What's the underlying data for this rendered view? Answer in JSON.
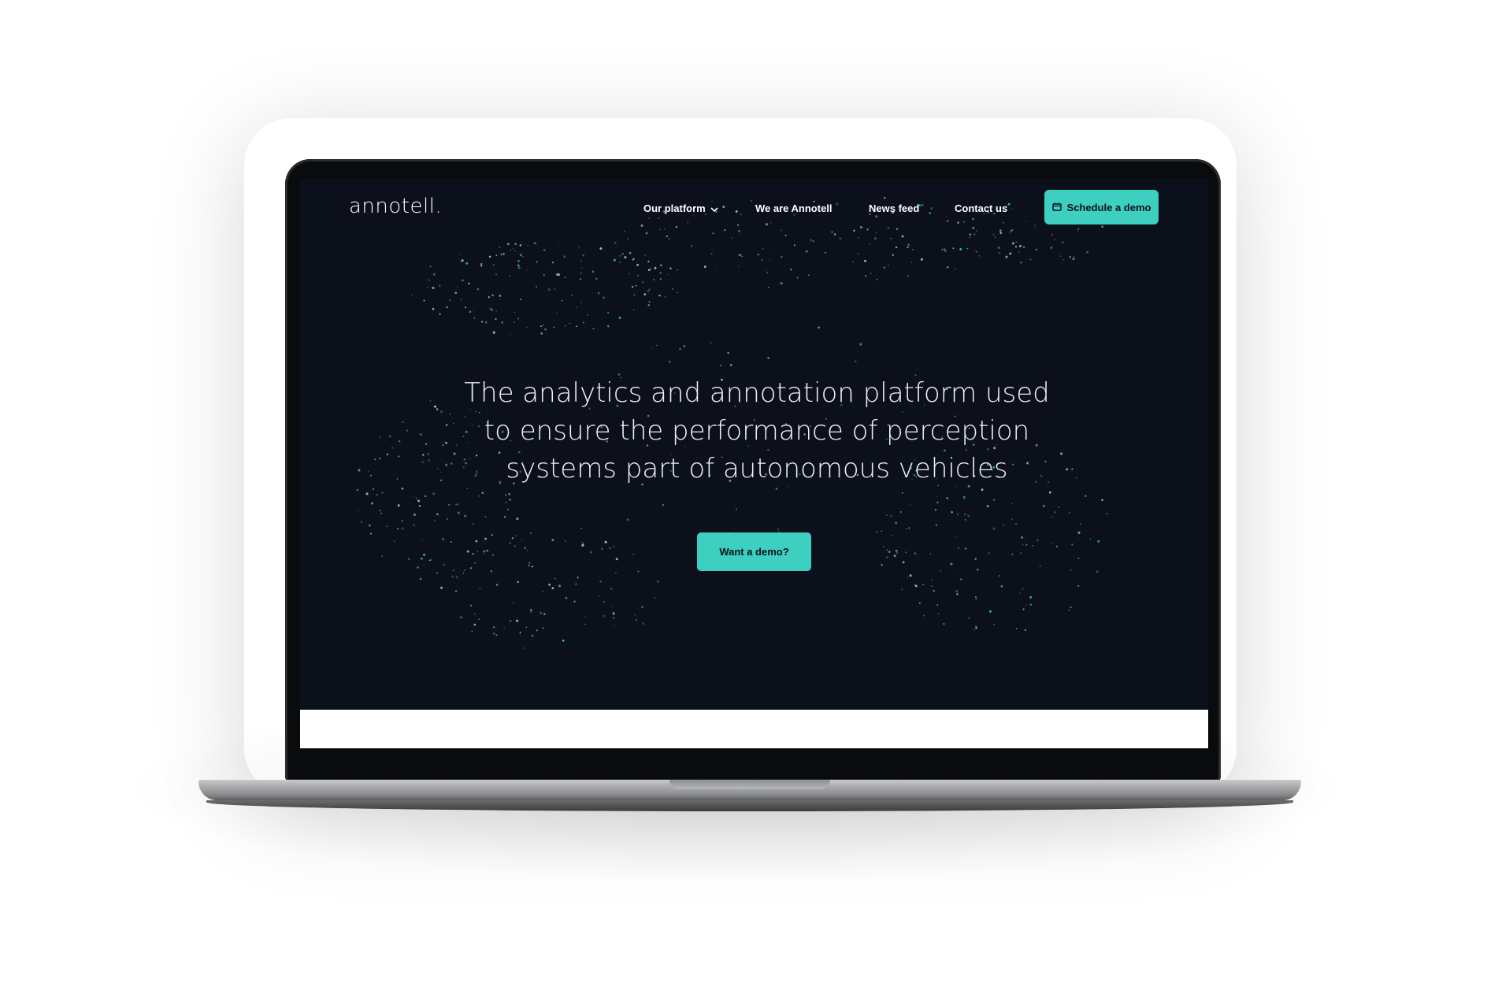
{
  "brand": {
    "logo_text": "annotell."
  },
  "nav": {
    "items": [
      {
        "label": "Our platform",
        "has_dropdown": true
      },
      {
        "label": "We are Annotell",
        "has_dropdown": false
      },
      {
        "label": "News feed",
        "has_dropdown": false
      },
      {
        "label": "Contact us",
        "has_dropdown": false
      }
    ],
    "cta_label": "Schedule a demo",
    "cta_icon": "calendar-icon"
  },
  "hero": {
    "headline": "The analytics and annotation platform used to ensure the performance of perception systems part of autonomous vehicles",
    "cta_label": "Want a demo?"
  },
  "colors": {
    "background": "#0b101b",
    "accent": "#3dcfc0",
    "text": "#ffffff"
  }
}
